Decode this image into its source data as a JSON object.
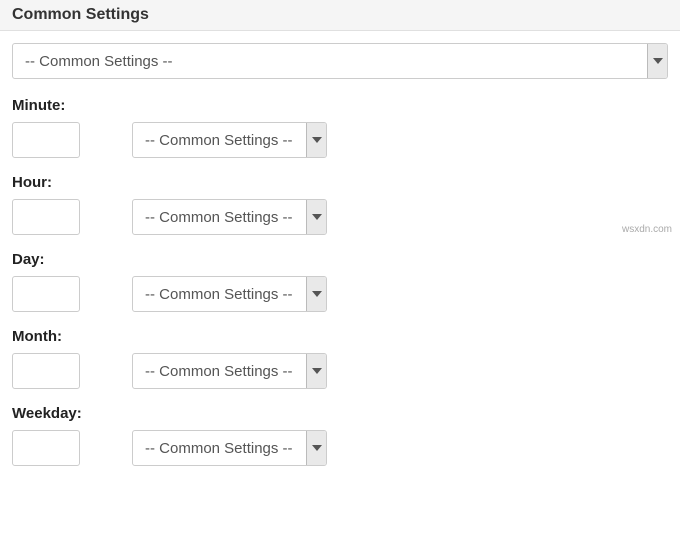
{
  "header": {
    "title": "Common Settings"
  },
  "common_select": {
    "selected": "-- Common Settings --"
  },
  "fields": {
    "minute": {
      "label": "Minute:",
      "value": "",
      "select_selected": "-- Common Settings --"
    },
    "hour": {
      "label": "Hour:",
      "value": "",
      "select_selected": "-- Common Settings --"
    },
    "day": {
      "label": "Day:",
      "value": "",
      "select_selected": "-- Common Settings --"
    },
    "month": {
      "label": "Month:",
      "value": "",
      "select_selected": "-- Common Settings --"
    },
    "weekday": {
      "label": "Weekday:",
      "value": "",
      "select_selected": "-- Common Settings --"
    }
  },
  "watermark": "wsxdn.com"
}
